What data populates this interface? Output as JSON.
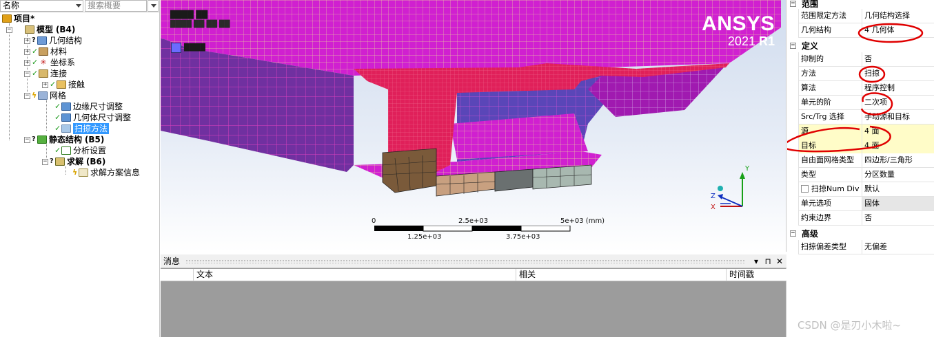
{
  "tree": {
    "header": {
      "name_label": "名称",
      "search_placeholder": "搜索概要"
    },
    "items": [
      {
        "label": "项目*"
      },
      {
        "label": "模型",
        "suffix": "(B4)"
      },
      {
        "label": "几何结构"
      },
      {
        "label": "材料"
      },
      {
        "label": "坐标系"
      },
      {
        "label": "连接"
      },
      {
        "label": "接触"
      },
      {
        "label": "网格"
      },
      {
        "label": "边缘尺寸调整"
      },
      {
        "label": "几何体尺寸调整"
      },
      {
        "label": "扫掠方法"
      },
      {
        "label": "静态结构",
        "suffix": "(B5)"
      },
      {
        "label": "分析设置"
      },
      {
        "label": "求解",
        "suffix": "(B6)"
      },
      {
        "label": "求解方案信息"
      }
    ]
  },
  "viewport": {
    "logo_brand": "ANSYS",
    "logo_year": "2021",
    "logo_release": "R1",
    "scale": {
      "labels_top": [
        "0",
        "2.5e+03",
        "5e+03 (mm)"
      ],
      "labels_bottom": [
        "1.25e+03",
        "3.75e+03"
      ]
    },
    "triad": {
      "y": "Y",
      "z": "Z",
      "x": "X"
    }
  },
  "messages": {
    "title": "消息",
    "buttons": [
      "▾",
      "⊓",
      "✕"
    ],
    "columns": [
      "文本",
      "相关",
      "时间戳"
    ]
  },
  "details": {
    "sections": [
      {
        "title": "范围"
      },
      {
        "title": "定义"
      },
      {
        "title": "高级"
      }
    ],
    "scope_rows": [
      {
        "key": "范围限定方法",
        "value": "几何结构选择"
      },
      {
        "key": "几何结构",
        "value": "4 几何体"
      }
    ],
    "definition_rows": [
      {
        "key": "抑制的",
        "value": "否"
      },
      {
        "key": "方法",
        "value": "扫掠"
      },
      {
        "key": "算法",
        "value": "程序控制"
      },
      {
        "key": "单元的阶",
        "value": "二次项"
      },
      {
        "key": "Src/Trg 选择",
        "value": "手动源和目标"
      },
      {
        "key": "源",
        "value": "4 面"
      },
      {
        "key": "目标",
        "value": "4 面"
      },
      {
        "key": "自由面网格类型",
        "value": "四边形/三角形"
      },
      {
        "key": "类型",
        "value": "分区数量"
      },
      {
        "key": "扫掠Num Div",
        "value": "默认"
      },
      {
        "key": "单元选项",
        "value": "固体"
      },
      {
        "key": "约束边界",
        "value": "否"
      }
    ],
    "advanced_rows": [
      {
        "key": "扫掠偏差类型",
        "value": "无偏差"
      }
    ]
  },
  "watermark": "CSDN @是刃小木啦~",
  "colors": {
    "mesh_magenta": "#d020d0",
    "mesh_edges": "#e8d090",
    "section_red": "#e0205a",
    "selection_blue": "#3399ff",
    "annotation_red": "#e00000"
  }
}
